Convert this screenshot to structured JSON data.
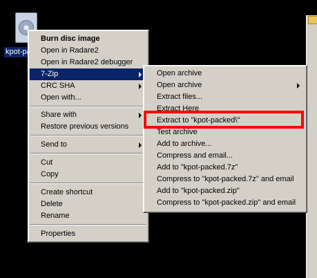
{
  "desktop": {
    "file_label": "kpot-packed"
  },
  "context_menu": {
    "items": [
      {
        "label": "Burn disc image"
      },
      {
        "label": "Open in Radare2"
      },
      {
        "label": "Open in Radare2 debugger"
      },
      {
        "label": "7-Zip"
      },
      {
        "label": "CRC SHA"
      },
      {
        "label": "Open with..."
      },
      {
        "label": "Share with"
      },
      {
        "label": "Restore previous versions"
      },
      {
        "label": "Send to"
      },
      {
        "label": "Cut"
      },
      {
        "label": "Copy"
      },
      {
        "label": "Create shortcut"
      },
      {
        "label": "Delete"
      },
      {
        "label": "Rename"
      },
      {
        "label": "Properties"
      }
    ]
  },
  "zip_submenu": {
    "items": [
      {
        "label": "Open archive"
      },
      {
        "label": "Open archive"
      },
      {
        "label": "Extract files..."
      },
      {
        "label": "Extract Here"
      },
      {
        "label": "Extract to \"kpot-packed\\\""
      },
      {
        "label": "Test archive"
      },
      {
        "label": "Add to archive..."
      },
      {
        "label": "Compress and email..."
      },
      {
        "label": "Add to \"kpot-packed.7z\""
      },
      {
        "label": "Compress to \"kpot-packed.7z\" and email"
      },
      {
        "label": "Add to \"kpot-packed.zip\""
      },
      {
        "label": "Compress to \"kpot-packed.zip\" and email"
      }
    ]
  },
  "annotation": {
    "highlight_color": "#ff0000"
  }
}
